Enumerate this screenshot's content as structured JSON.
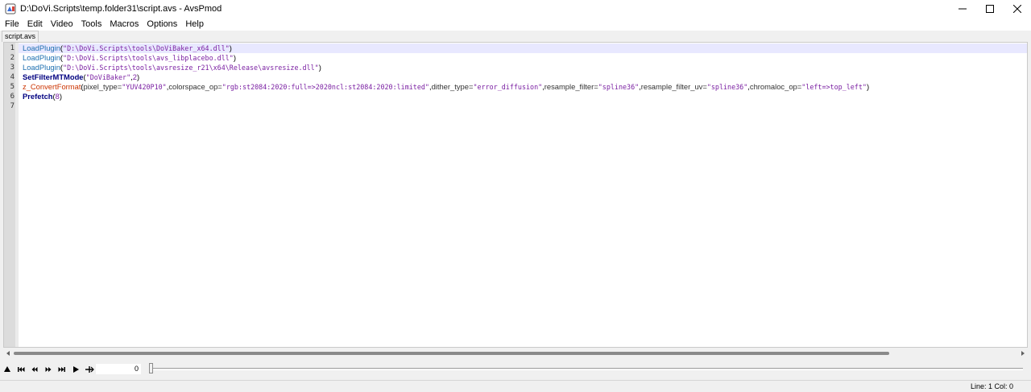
{
  "window": {
    "title": "D:\\DoVi.Scripts\\temp.folder31\\script.avs - AvsPmod"
  },
  "menu": [
    "File",
    "Edit",
    "Video",
    "Tools",
    "Macros",
    "Options",
    "Help"
  ],
  "tabs": [
    {
      "label": "script.avs"
    }
  ],
  "editor": {
    "line_numbers": [
      "1",
      "2",
      "3",
      "4",
      "5",
      "6",
      "7"
    ],
    "lines": [
      {
        "fn": "LoadPlugin",
        "open": "(",
        "arg": "\"D:\\DoVi.Scripts\\tools\\DoViBaker_x64.dll\"",
        "close": ")"
      },
      {
        "fn": "LoadPlugin",
        "open": "(",
        "arg": "\"D:\\DoVi.Scripts\\tools\\avs_libplacebo.dll\"",
        "close": ")"
      },
      {
        "fn": "LoadPlugin",
        "open": "(",
        "arg": "\"D:\\DoVi.Scripts\\tools\\avsresize_r21\\x64\\Release\\avsresize.dll\"",
        "close": ")"
      },
      {
        "fn": "SetFilterMTMode",
        "open": "(",
        "arg": "\"DoViBaker\"",
        "sep": ",",
        "num": "2",
        "close": ")"
      },
      {
        "fn": "z_ConvertFormat",
        "open": "(",
        "params": [
          {
            "name": "pixel_type=",
            "value": "\"YUV420P10\"",
            "sep": ","
          },
          {
            "name": "colorspace_op=",
            "value": "\"rgb:st2084:2020:full=>2020ncl:st2084:2020:limited\"",
            "sep": ","
          },
          {
            "name": "dither_type=",
            "value": "\"error_diffusion\"",
            "sep": ","
          },
          {
            "name": "resample_filter=",
            "value": "\"spline36\"",
            "sep": ","
          },
          {
            "name": "resample_filter_uv=",
            "value": "\"spline36\"",
            "sep": ","
          },
          {
            "name": "chromaloc_op=",
            "value": "\"left=>top_left\"",
            "sep": ""
          }
        ],
        "close": ")"
      },
      {
        "fn": "Prefetch",
        "open": "(",
        "num": "8",
        "close": ")"
      },
      {}
    ]
  },
  "transport": {
    "frame_value": "0"
  },
  "status": {
    "text": "Line: 1  Col: 0"
  },
  "icons": {
    "app": "avspmod-app-icon",
    "minimize": "minimize-icon",
    "maximize": "maximize-icon",
    "close": "close-icon"
  }
}
